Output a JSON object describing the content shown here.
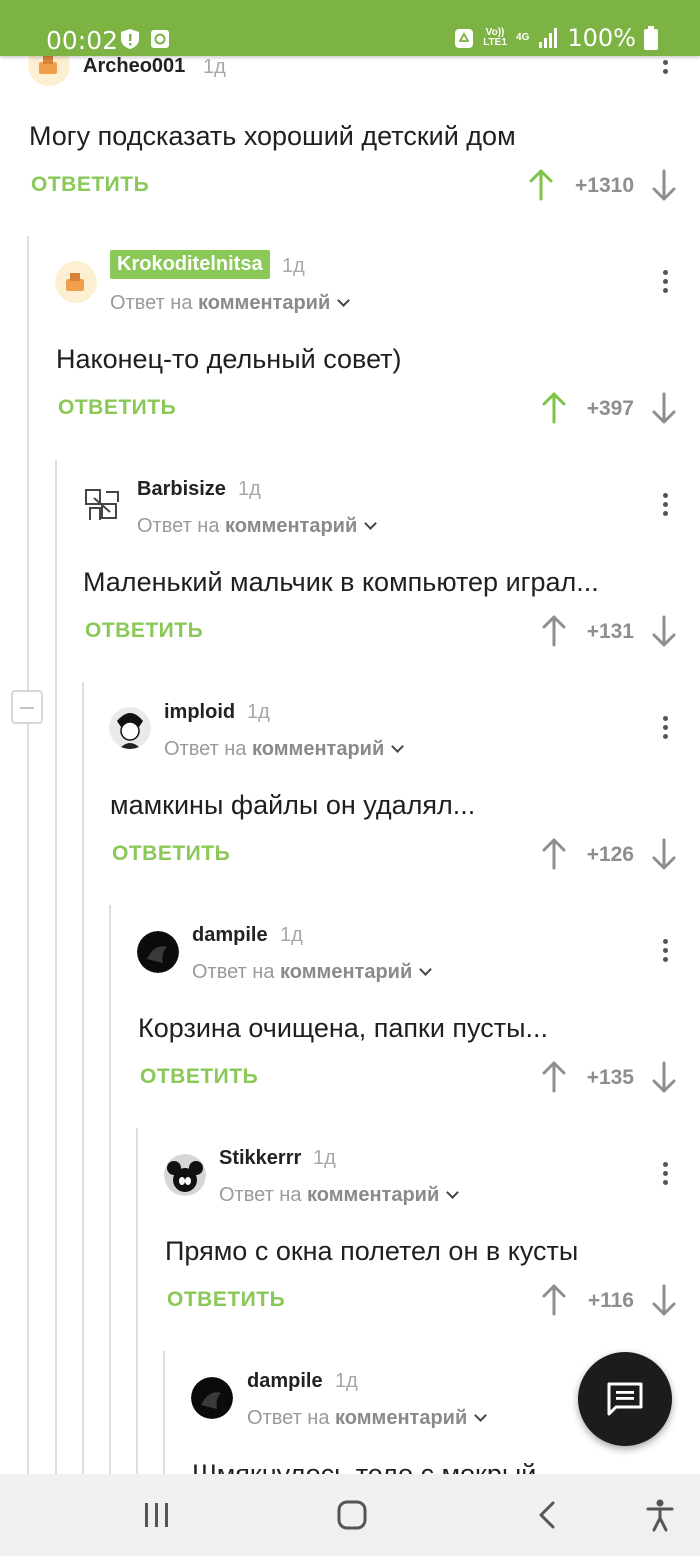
{
  "status_bar": {
    "time": "00:02",
    "battery_text": "100%",
    "network": {
      "volte": "Vo)) LTE1",
      "gen": "4G"
    },
    "background_color": "#7cb342"
  },
  "labels": {
    "reply_action": "ОТВЕТИТЬ",
    "reply_to_prefix": "Ответ на",
    "reply_to_target": "комментарий"
  },
  "comments": [
    {
      "author": "Archeo001",
      "age": "1д",
      "text": "Могу подсказать хороший детский дом",
      "rating": "+1310",
      "voted": "up"
    },
    {
      "author": "Krokoditelnitsa",
      "age": "1д",
      "text": "Наконец-то дельный совет)",
      "rating": "+397",
      "voted": "up"
    },
    {
      "author": "Barbisize",
      "age": "1д",
      "text": "Маленький мальчик в компьютер играл...",
      "rating": "+131",
      "voted": "none"
    },
    {
      "author": "imploid",
      "age": "1д",
      "text": "мамкины файлы он удалял...",
      "rating": "+126",
      "voted": "none"
    },
    {
      "author": "dampile",
      "age": "1д",
      "text": "Корзина очищена, папки пусты...",
      "rating": "+135",
      "voted": "none"
    },
    {
      "author": "Stikkerrr",
      "age": "1д",
      "text": "Прямо с окна полетел он в кусты",
      "rating": "+116",
      "voted": "none"
    },
    {
      "author": "dampile",
      "age": "1д",
      "text": "Шмякнулось тело с мокрый...",
      "rating": "",
      "voted": "none"
    }
  ],
  "icons": {
    "fab": "comment-icon",
    "nav": [
      "recent-apps-icon",
      "home-icon",
      "back-icon",
      "accessibility-icon"
    ]
  },
  "colors": {
    "accent": "#8ac858",
    "upvoted": "#7cc243",
    "text": "#1f1f1f",
    "muted": "#9a9a9a"
  }
}
